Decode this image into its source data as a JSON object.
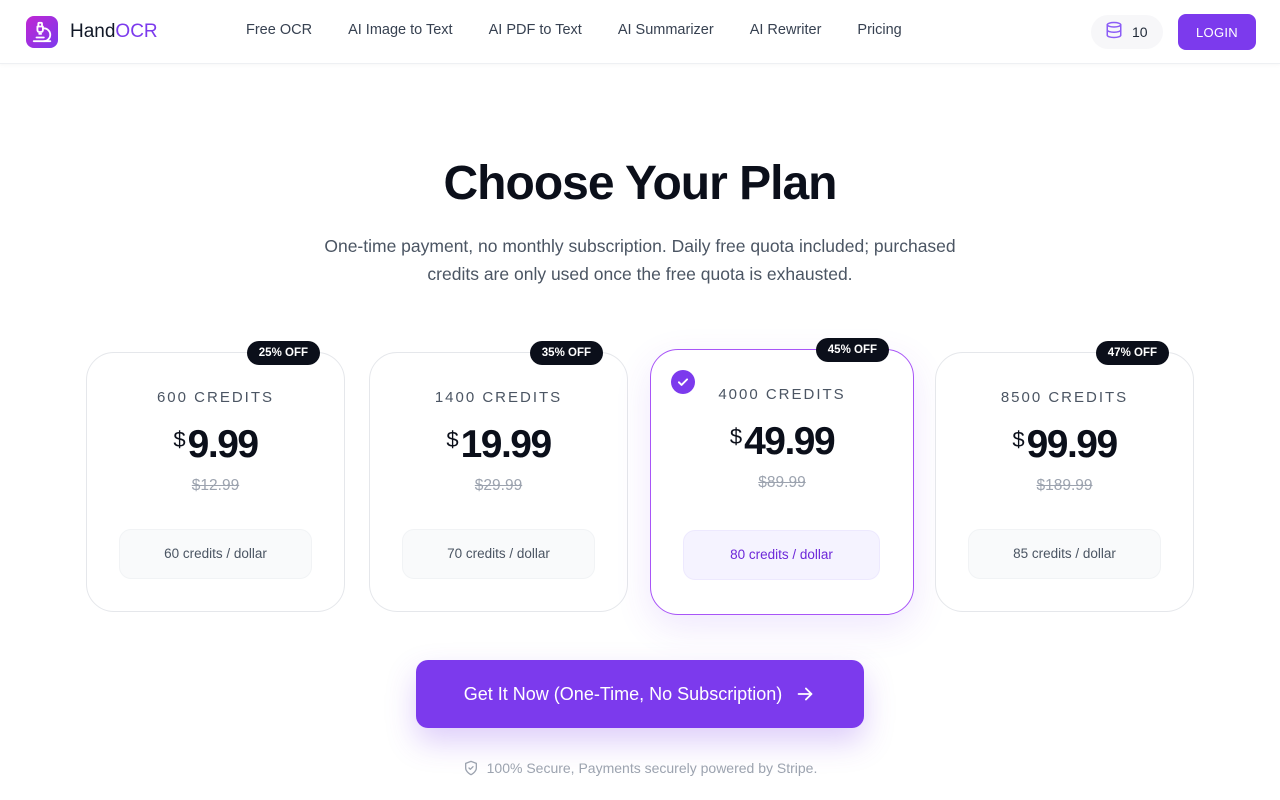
{
  "brand": {
    "name_main": "Hand",
    "name_accent": "OCR"
  },
  "nav": [
    {
      "label": "Free OCR"
    },
    {
      "label": "AI Image to Text"
    },
    {
      "label": "AI PDF to Text"
    },
    {
      "label": "AI Summarizer"
    },
    {
      "label": "AI Rewriter"
    },
    {
      "label": "Pricing"
    }
  ],
  "header": {
    "credits": "10",
    "login_label": "LOGIN"
  },
  "hero": {
    "title": "Choose Your Plan",
    "subtitle": "One-time payment, no monthly subscription. Daily free quota included; purchased credits are only used once the free quota is exhausted."
  },
  "plans": [
    {
      "badge": "25% OFF",
      "label": "600 CREDITS",
      "currency": "$",
      "price": "9.99",
      "old_price": "$12.99",
      "rate": "60 credits / dollar",
      "selected": false
    },
    {
      "badge": "35% OFF",
      "label": "1400 CREDITS",
      "currency": "$",
      "price": "19.99",
      "old_price": "$29.99",
      "rate": "70 credits / dollar",
      "selected": false
    },
    {
      "badge": "45% OFF",
      "label": "4000 CREDITS",
      "currency": "$",
      "price": "49.99",
      "old_price": "$89.99",
      "rate": "80 credits / dollar",
      "selected": true
    },
    {
      "badge": "47% OFF",
      "label": "8500 CREDITS",
      "currency": "$",
      "price": "99.99",
      "old_price": "$189.99",
      "rate": "85 credits / dollar",
      "selected": false
    }
  ],
  "cta": {
    "label": "Get It Now (One-Time, No Subscription)"
  },
  "footer": {
    "secure_text": "100% Secure, Payments securely powered by Stripe."
  },
  "colors": {
    "accent": "#7c3aed",
    "badge_bg": "#0b0f1a"
  },
  "icons": {
    "logo": "microscope-icon",
    "credits": "database-icon",
    "check": "check-icon",
    "cta": "arrow-right-icon",
    "secure": "shield-check-icon"
  }
}
